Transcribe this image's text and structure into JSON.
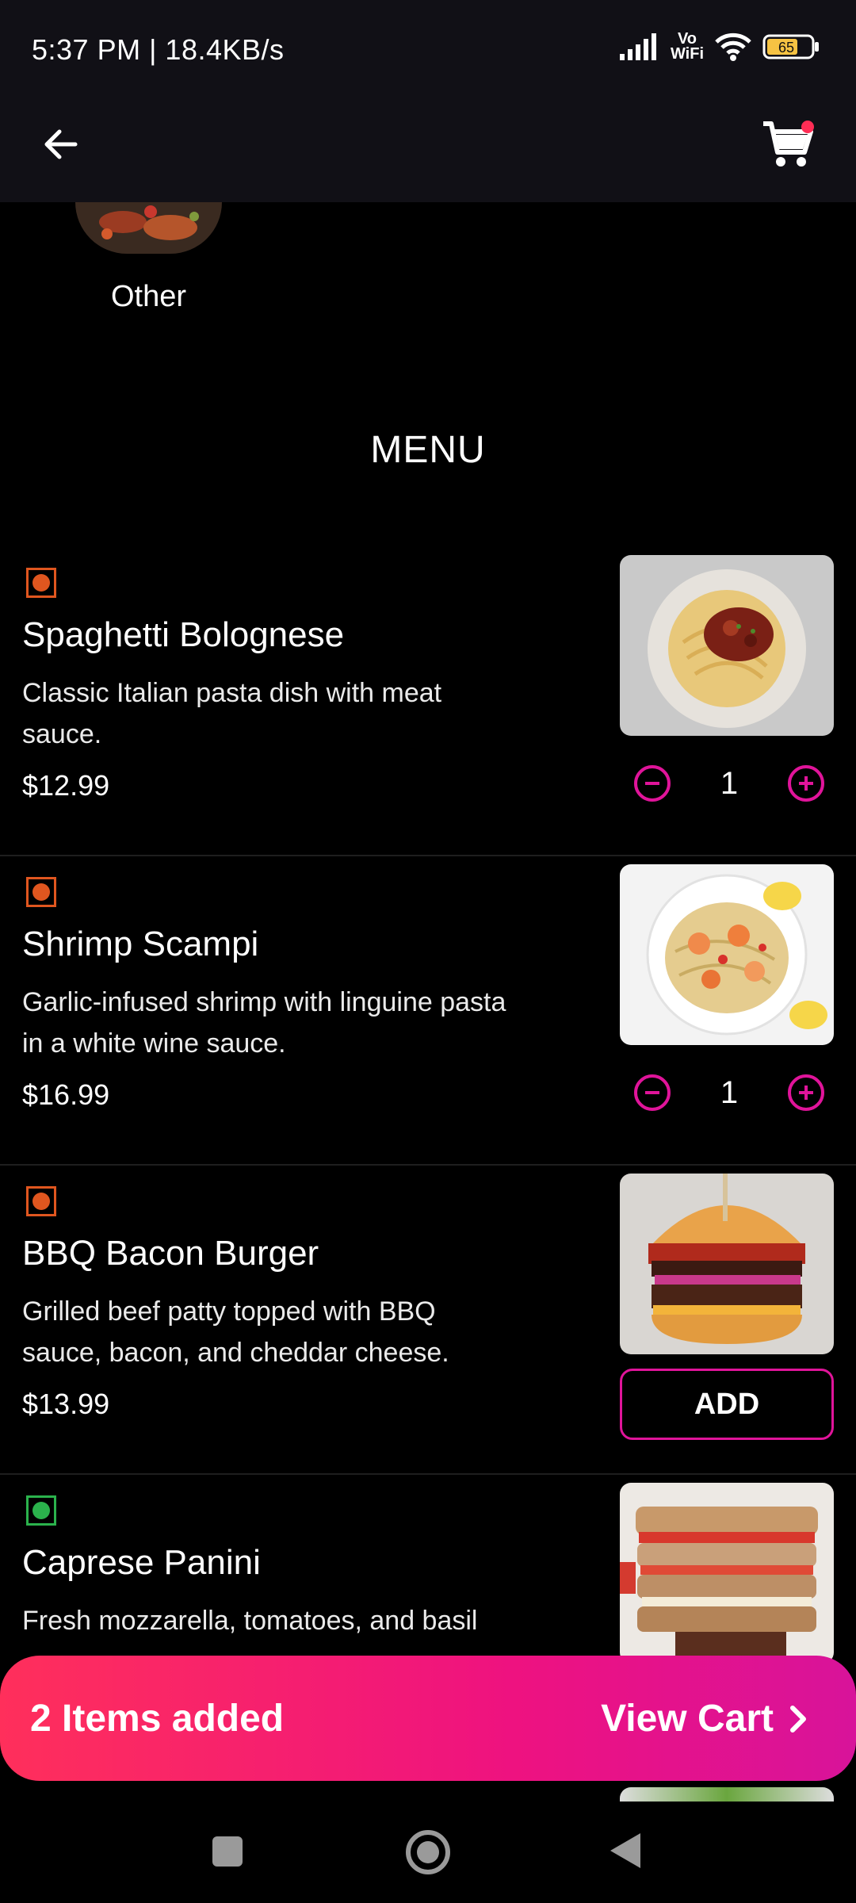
{
  "status": {
    "time_speed": "5:37 PM | 18.4KB/s",
    "battery": "65",
    "network": "Vo WiFi"
  },
  "appbar": {
    "back_icon": "arrow-left-icon",
    "cart_icon": "cart-icon"
  },
  "category": {
    "label": "Other"
  },
  "menu": {
    "title": "MENU",
    "items": [
      {
        "name": "Spaghetti Bolognese",
        "desc": "Classic Italian pasta dish with meat sauce.",
        "price": "$12.99",
        "qty": "1",
        "veg": false
      },
      {
        "name": "Shrimp Scampi",
        "desc": "Garlic-infused shrimp with linguine pasta in a white wine sauce.",
        "price": "$16.99",
        "qty": "1",
        "veg": false
      },
      {
        "name": "BBQ Bacon Burger",
        "desc": "Grilled beef patty topped with BBQ sauce, bacon, and cheddar cheese.",
        "price": "$13.99",
        "add_label": "ADD",
        "veg": false
      },
      {
        "name": "Caprese Panini",
        "desc": "Fresh mozzarella, tomatoes, and basil",
        "veg": true
      }
    ]
  },
  "cart_bar": {
    "count_text": "2 Items added",
    "view_cart": "View Cart"
  },
  "colors": {
    "accent": "#e0149a",
    "nonveg": "#e0561f",
    "veg": "#2bb24c"
  }
}
